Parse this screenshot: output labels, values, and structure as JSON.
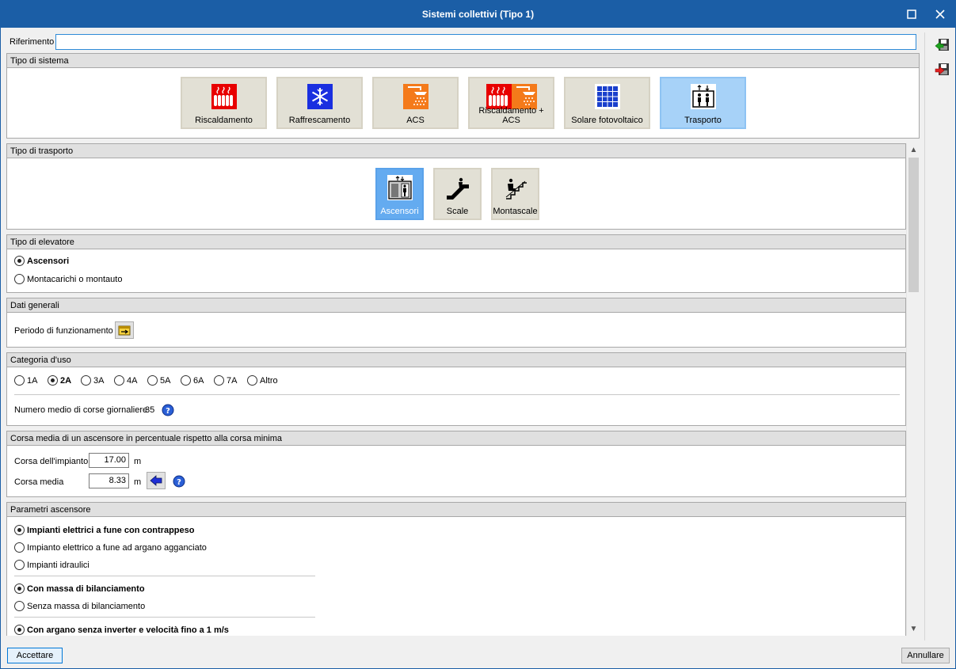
{
  "window": {
    "title": "Sistemi collettivi (Tipo 1)"
  },
  "riferimento": {
    "label": "Riferimento",
    "value": ""
  },
  "tipo_sistema": {
    "header": "Tipo di sistema",
    "buttons": [
      {
        "label": "Riscaldamento",
        "icon": "radiator-icon",
        "active": false
      },
      {
        "label": "Raffrescamento",
        "icon": "snowflake-icon",
        "active": false
      },
      {
        "label": "ACS",
        "icon": "shower-icon",
        "active": false
      },
      {
        "label": "Riscaldamento + ACS",
        "icon": "radiator-shower-icon",
        "active": false
      },
      {
        "label": "Solare fotovoltaico",
        "icon": "solar-panel-icon",
        "active": false
      },
      {
        "label": "Trasporto",
        "icon": "elevator-icon",
        "active": true
      }
    ]
  },
  "tipo_trasporto": {
    "header": "Tipo di trasporto",
    "buttons": [
      {
        "label": "Ascensori",
        "icon": "lift-icon",
        "active": true
      },
      {
        "label": "Scale",
        "icon": "escalator-icon",
        "active": false
      },
      {
        "label": "Montascale",
        "icon": "stairlift-icon",
        "active": false
      }
    ]
  },
  "tipo_elevatore": {
    "header": "Tipo di elevatore",
    "options": [
      {
        "label": "Ascensori",
        "selected": true
      },
      {
        "label": "Montacarichi o montauto",
        "selected": false
      }
    ]
  },
  "dati_generali": {
    "header": "Dati generali",
    "periodo_label": "Periodo di funzionamento"
  },
  "categoria_uso": {
    "header": "Categoria d'uso",
    "options": [
      "1A",
      "2A",
      "3A",
      "4A",
      "5A",
      "6A",
      "7A",
      "Altro"
    ],
    "selected": "2A",
    "corse_label": "Numero medio di corse giornaliere",
    "corse_value": "35"
  },
  "corsa_media": {
    "header": "Corsa media di un ascensore in percentuale rispetto alla corsa minima",
    "impianto_label": "Corsa dell'impianto",
    "impianto_value": "17.00",
    "impianto_unit": "m",
    "media_label": "Corsa media",
    "media_value": "8.33",
    "media_unit": "m"
  },
  "parametri": {
    "header": "Parametri ascensore",
    "group1": [
      {
        "label": "Impianti elettrici a fune con contrappeso",
        "selected": true
      },
      {
        "label": "Impianto elettrico a fune ad argano agganciato",
        "selected": false
      },
      {
        "label": "Impianti idraulici",
        "selected": false
      }
    ],
    "group2": [
      {
        "label": "Con massa di bilanciamento",
        "selected": true
      },
      {
        "label": "Senza massa di bilanciamento",
        "selected": false
      }
    ],
    "group3": [
      {
        "label": "Con argano senza inverter e velocità fino a 1 m/s",
        "selected": true
      }
    ]
  },
  "footer": {
    "accept": "Accettare",
    "cancel": "Annullare"
  },
  "colors": {
    "titlebar": "#1b5ea6",
    "active_button": "#a7d2f8",
    "active_transport": "#64abf0",
    "accent": "#2e8bd8"
  }
}
